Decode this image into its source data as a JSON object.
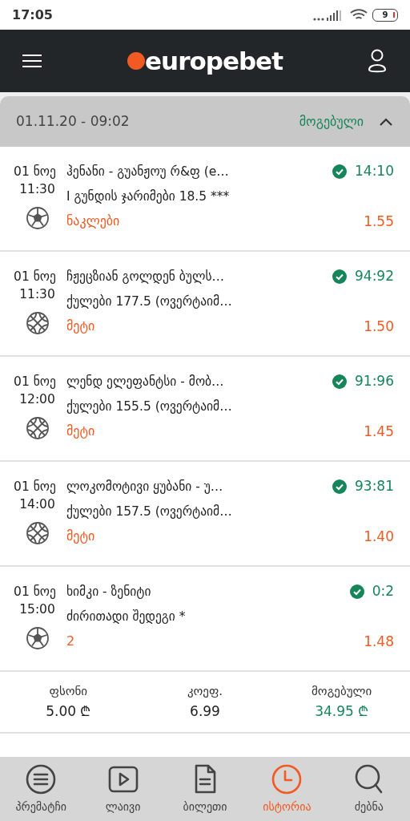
{
  "status_bar": {
    "time": "17:05",
    "battery": "9"
  },
  "header": {
    "logo": "europebet"
  },
  "ticket": {
    "datetime": "01.11.20 - 09:02",
    "status": "მოგებული",
    "expanded": true,
    "bets": [
      {
        "date": "01 ნოე",
        "time": "11:30",
        "kind": "football",
        "event": "ჰენანი - გუანჟოუ რ&ფ (e…",
        "market": "I გუნდის ჯარიმები 18.5 ***",
        "pick": "ნაკლები",
        "won": true,
        "score": "14:10",
        "odds": "1.55"
      },
      {
        "date": "01 ნოე",
        "time": "11:30",
        "kind": "basketball",
        "event": "ჩჟეცზიან გოლდენ ბულს…",
        "market": "ქულები 177.5 (ოვერტაიმ…",
        "pick": "მეტი",
        "won": true,
        "score": "94:92",
        "odds": "1.50"
      },
      {
        "date": "01 ნოე",
        "time": "12:00",
        "kind": "basketball",
        "event": "ლენდ ელეფანტსი - მობ…",
        "market": "ქულები 155.5 (ოვერტაიმ…",
        "pick": "მეტი",
        "won": true,
        "score": "91:96",
        "odds": "1.45"
      },
      {
        "date": "01 ნოე",
        "time": "14:00",
        "kind": "basketball",
        "event": "ლოკომოტივი ყუბანი - უ…",
        "market": "ქულები 157.5 (ოვერტაიმ…",
        "pick": "მეტი",
        "won": true,
        "score": "93:81",
        "odds": "1.40"
      },
      {
        "date": "01 ნოე",
        "time": "15:00",
        "kind": "football",
        "event": "ხიმკი - ზენიტი",
        "market": "ძირითადი შედეგი *",
        "pick": "2",
        "won": true,
        "score": "0:2",
        "odds": "1.48"
      }
    ],
    "summary": [
      {
        "label": "ფსონი",
        "value": "5.00 ₾",
        "kind": "plain"
      },
      {
        "label": "კოეფ.",
        "value": "6.99",
        "kind": "plain"
      },
      {
        "label": "მოგებული",
        "value": "34.95 ₾",
        "kind": "win"
      }
    ]
  },
  "nav": [
    {
      "label": "პრემატჩი",
      "selected": false
    },
    {
      "label": "ლაივი",
      "selected": false
    },
    {
      "label": "ბილეთი",
      "selected": false
    },
    {
      "label": "ისტორია",
      "selected": true
    },
    {
      "label": "ძებნა",
      "selected": false
    }
  ]
}
